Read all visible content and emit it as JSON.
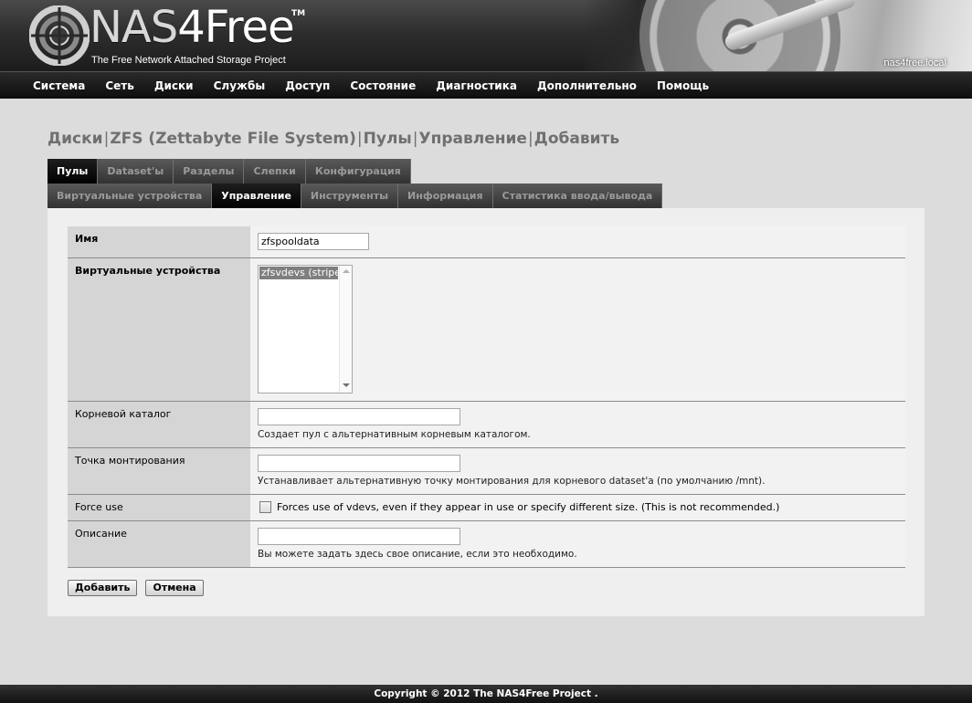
{
  "header": {
    "logo_prefix": "NAS",
    "logo_suffix": "4Free",
    "trademark": "TM",
    "tagline": "The Free Network Attached Storage Project",
    "hostname": "nas4free.local"
  },
  "nav": {
    "items": [
      "Система",
      "Сеть",
      "Диски",
      "Службы",
      "Доступ",
      "Состояние",
      "Диагностика",
      "Дополнительно",
      "Помощь"
    ]
  },
  "breadcrumb": {
    "parts": [
      "Диски",
      "ZFS (Zettabyte File System)",
      "Пулы",
      "Управление",
      "Добавить"
    ],
    "separator": "|"
  },
  "tabs_primary": [
    {
      "label": "Пулы",
      "active": true
    },
    {
      "label": "Dataset'ы",
      "active": false
    },
    {
      "label": "Разделы",
      "active": false
    },
    {
      "label": "Слепки",
      "active": false
    },
    {
      "label": "Конфигурация",
      "active": false
    }
  ],
  "tabs_secondary": [
    {
      "label": "Виртуальные устройства",
      "active": false
    },
    {
      "label": "Управление",
      "active": true
    },
    {
      "label": "Инструменты",
      "active": false
    },
    {
      "label": "Информация",
      "active": false
    },
    {
      "label": "Статистика ввода/вывода",
      "active": false
    }
  ],
  "form": {
    "name_label": "Имя",
    "name_value": "zfspooldata",
    "vdevs_label": "Виртуальные устройства",
    "vdevs_options": [
      "zfsvdevs (stripe)"
    ],
    "root_label": "Корневой каталог",
    "root_value": "",
    "root_hint": "Создает пул с альтернативным корневым каталогом.",
    "mount_label": "Точка монтирования",
    "mount_value": "",
    "mount_hint": "Устанавливает альтернативную точку монтирования для корневого dataset'a (по умолчанию /mnt).",
    "force_label": "Force use",
    "force_checked": false,
    "force_text": "Forces use of vdevs, even if they appear in use or specify different size. (This is not recommended.)",
    "desc_label": "Описание",
    "desc_value": "",
    "desc_hint": "Вы можете задать здесь свое описание, если это необходимо."
  },
  "buttons": {
    "add": "Добавить",
    "cancel": "Отмена"
  },
  "footer": {
    "copyright": "Copyright © 2012 The NAS4Free Project ."
  },
  "colors": {
    "active_tab": "#000000",
    "inactive_tab": "#3c3c3c",
    "selected_option": "#7f7f7f"
  }
}
